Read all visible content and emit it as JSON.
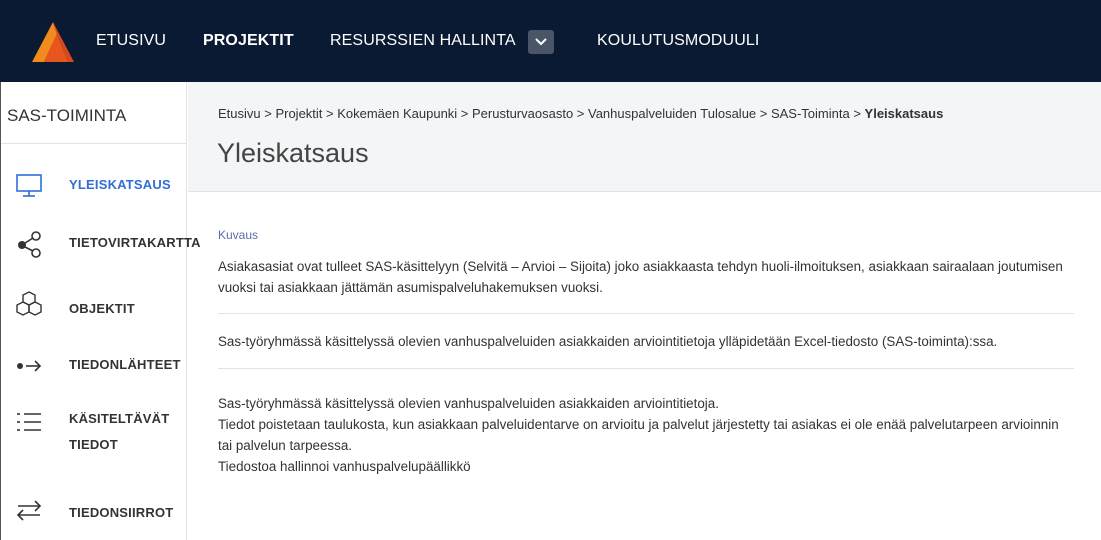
{
  "nav": {
    "items": [
      {
        "label": "ETUSIVU",
        "active": false
      },
      {
        "label": "PROJEKTIT",
        "active": true
      },
      {
        "label": "RESURSSIEN HALLINTA",
        "active": false
      },
      {
        "label": "KOULUTUSMODUULI",
        "active": false
      }
    ],
    "dropdown_icon": "chevron-down-icon"
  },
  "sidebar": {
    "title": "SAS-TOIMINTA",
    "items": [
      {
        "label": "YLEISKATSAUS",
        "icon": "monitor-icon",
        "active": true
      },
      {
        "label": "TIETOVIRTAKARTTA",
        "icon": "share-icon",
        "active": false
      },
      {
        "label": "OBJEKTIT",
        "icon": "cubes-icon",
        "active": false
      },
      {
        "label": "TIEDONLÄHTEET",
        "icon": "arrow-right-icon",
        "active": false
      },
      {
        "label_line1": "KÄSITELTÄVÄT",
        "label_line2": "TIEDOT",
        "icon": "list-icon",
        "active": false
      },
      {
        "label": "TIEDONSIIRROT",
        "icon": "swap-arrows-icon",
        "active": false
      }
    ]
  },
  "header": {
    "breadcrumb": {
      "path": "Etusivu > Projektit > Kokemäen Kaupunki > Perusturvaosasto > Vanhuspalveluiden Tulosalue > SAS-Toiminta > ",
      "current": "Yleiskatsaus"
    },
    "title": "Yleiskatsaus"
  },
  "content": {
    "description_label": "Kuvaus",
    "para1": "Asiakasasiat ovat tulleet SAS-käsittelyyn (Selvitä – Arvioi – Sijoita) joko asiakkaasta tehdyn huoli-ilmoituksen, asiakkaan sairaalaan joutumisen vuoksi tai asiakkaan jättämän asumispalveluhakemuksen vuoksi.",
    "para2": "Sas-työryhmässä käsittelyssä olevien vanhuspalveluiden asiakkaiden arviointitietoja ylläpidetään Excel-tiedosto (SAS-toiminta):ssa.",
    "para3_line1": "Sas-työryhmässä käsittelyssä olevien vanhuspalveluiden asiakkaiden arviointitietoja.",
    "para3_line2": "Tiedot poistetaan taulukosta, kun asiakkaan palveluidentarve on arvioitu ja palvelut järjestetty tai asiakas ei ole enää palvelutarpeen arvioinnin tai palvelun tarpeessa.",
    "para3_line3": "Tiedostoa hallinnoi vanhuspalvelupäällikkö"
  },
  "colors": {
    "topbar": "#0b1a33",
    "accent": "#2f6fd6",
    "logo_orange": "#e8561e"
  }
}
